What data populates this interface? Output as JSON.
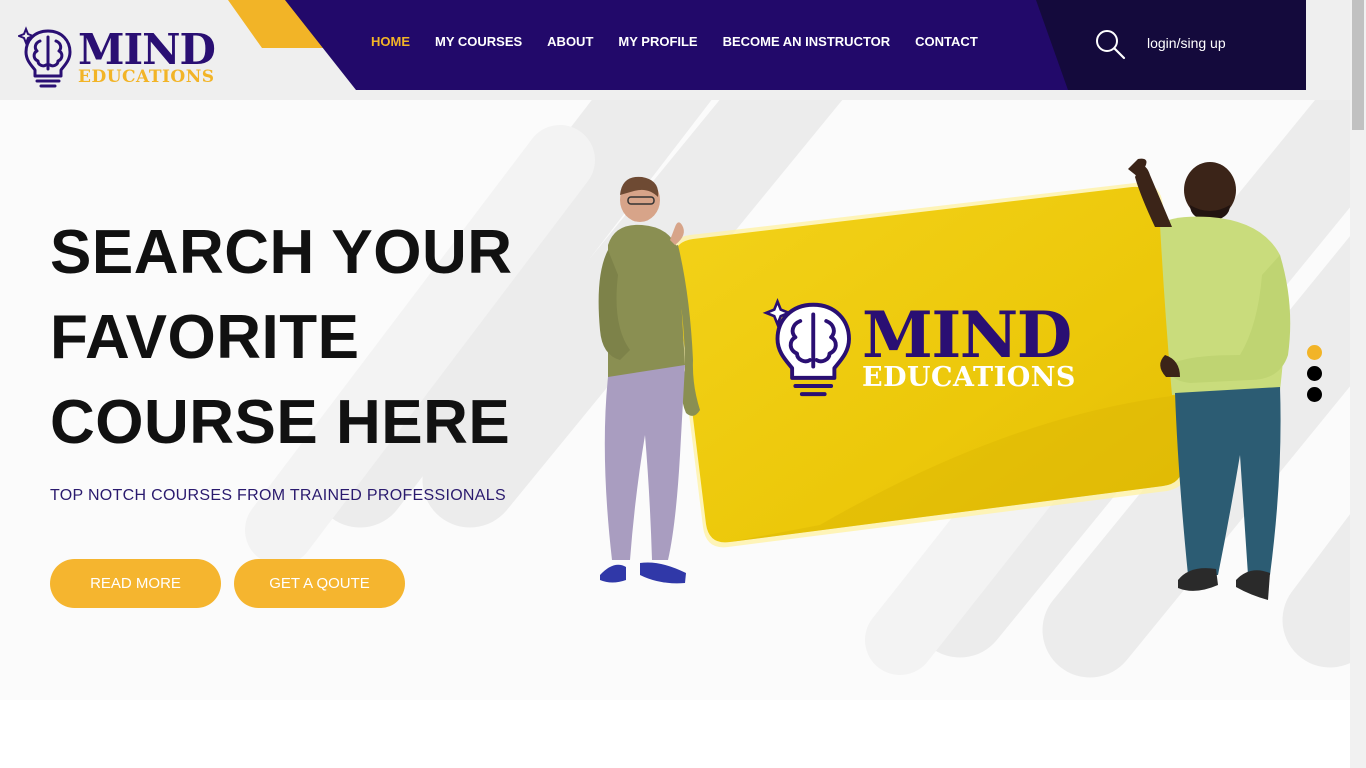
{
  "brand": {
    "name": "MIND",
    "tagline": "EDUCATIONS",
    "colors": {
      "primary": "#2a0f73",
      "accent": "#f2b427",
      "dark": "#140a3c"
    }
  },
  "nav": {
    "items": [
      {
        "label": "HOME",
        "active": true
      },
      {
        "label": "MY COURSES",
        "active": false
      },
      {
        "label": "ABOUT",
        "active": false
      },
      {
        "label": "MY PROFILE",
        "active": false
      },
      {
        "label": "BECOME AN INSTRUCTOR",
        "active": false
      },
      {
        "label": "CONTACT",
        "active": false
      }
    ],
    "search_icon": "search-icon",
    "login_label": "login/sing up"
  },
  "hero": {
    "title": "SEARCH YOUR\nFAVORITE\nCOURSE HERE",
    "subtitle": "TOP NOTCH COURSES FROM TRAINED PROFESSIONALS",
    "buttons": {
      "read_more": "READ MORE",
      "get_quote": "GET A QOUTE"
    },
    "card_brand": {
      "name": "MIND",
      "tagline": "EDUCATIONS"
    },
    "slider": {
      "count": 3,
      "active_index": 0
    }
  }
}
